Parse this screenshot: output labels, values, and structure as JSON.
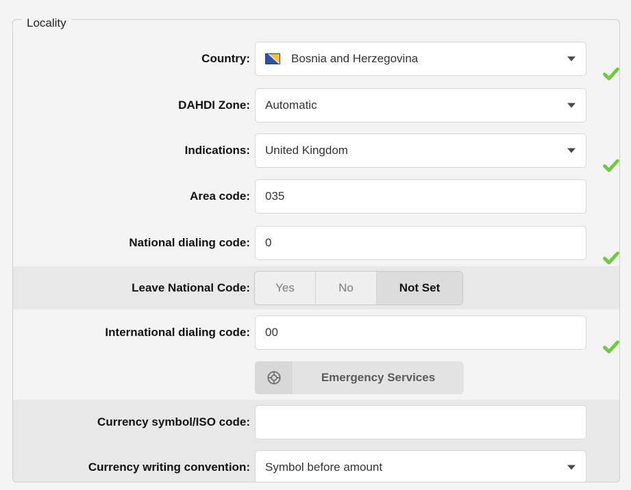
{
  "colors": {
    "accent_check": "#6ccb3e",
    "row_light": "#f4f4f4",
    "row_dark": "#e8e8e8",
    "border": "#cfcfcf",
    "flag_blue": "#2b54a4",
    "flag_yellow": "#f2c230",
    "flag_white": "#ffffff"
  },
  "fieldset": {
    "legend": "Locality"
  },
  "rows": {
    "country": {
      "label": "Country:",
      "value": "Bosnia and Herzegovina",
      "flag_icon": "flag-bosnia-and-herzegovina",
      "caret_icon": "chevron-down-icon",
      "valid_icon": "check-icon"
    },
    "dahdi_zone": {
      "label": "DAHDI Zone:",
      "value": "Automatic",
      "caret_icon": "chevron-down-icon"
    },
    "indications": {
      "label": "Indications:",
      "value": "United Kingdom",
      "caret_icon": "chevron-down-icon",
      "valid_icon": "check-icon"
    },
    "area_code": {
      "label": "Area code:",
      "value": "035",
      "placeholder": ""
    },
    "national_dialing_code": {
      "label": "National dialing code:",
      "value": "0",
      "placeholder": "",
      "valid_icon": "check-icon"
    },
    "leave_national_code": {
      "label": "Leave National Code:",
      "options": [
        "Yes",
        "No",
        "Not Set"
      ],
      "selected": "Not Set"
    },
    "international_dialing_code": {
      "label": "International dialing code:",
      "value": "00",
      "placeholder": "",
      "valid_icon": "check-icon"
    },
    "emergency_services": {
      "label": "Emergency Services",
      "icon": "lifebuoy-icon"
    },
    "currency_symbol": {
      "label": "Currency symbol/ISO code:",
      "value": "",
      "placeholder": ""
    },
    "currency_convention": {
      "label": "Currency writing convention:",
      "value": "Symbol before amount",
      "caret_icon": "chevron-down-icon"
    }
  }
}
